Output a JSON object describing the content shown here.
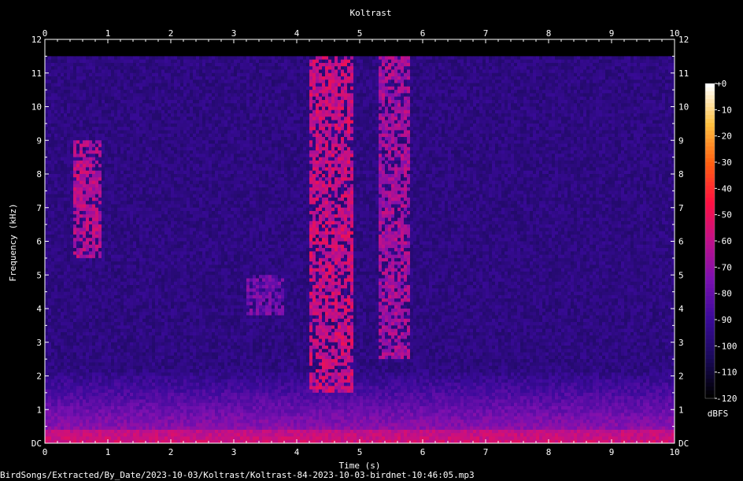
{
  "chart_data": {
    "type": "heatmap",
    "title": "Koltrast",
    "xlabel": "Time (s)",
    "ylabel": "Frequency (kHz)",
    "xlim": [
      0,
      10
    ],
    "ylim": [
      0,
      12
    ],
    "x_ticks": [
      "0",
      "1",
      "2",
      "3",
      "4",
      "5",
      "6",
      "7",
      "8",
      "9",
      "10"
    ],
    "y_ticks": [
      "DC",
      "1",
      "2",
      "3",
      "4",
      "5",
      "6",
      "7",
      "8",
      "9",
      "10",
      "11",
      "12"
    ],
    "colorbar": {
      "label": "dBFS",
      "range": [
        -120,
        0
      ],
      "ticks": [
        "+0",
        "-10",
        "-20",
        "-30",
        "-40",
        "-50",
        "-60",
        "-70",
        "-80",
        "-90",
        "-100",
        "-110",
        "-120"
      ]
    },
    "grid": false,
    "colors": {
      "background": "#000000",
      "colormap": [
        "#000000",
        "#1a0a5a",
        "#3a0a9a",
        "#7a10b0",
        "#c0108a",
        "#ff1040",
        "#ff6010",
        "#ffc040",
        "#ffffff"
      ]
    },
    "events": [
      {
        "t_start": 0.45,
        "t_end": 0.9,
        "f_low": 5.5,
        "f_high": 9.0,
        "level_db": -62
      },
      {
        "t_start": 3.2,
        "t_end": 3.8,
        "f_low": 3.8,
        "f_high": 5.0,
        "level_db": -78
      },
      {
        "t_start": 4.2,
        "t_end": 4.9,
        "f_low": 1.5,
        "f_high": 11.5,
        "level_db": -58
      },
      {
        "t_start": 5.3,
        "t_end": 5.8,
        "f_low": 2.5,
        "f_high": 11.5,
        "level_db": -66
      }
    ]
  },
  "footer": {
    "path": "BirdSongs/Extracted/By_Date/2023-10-03/Koltrast/Koltrast-84-2023-10-03-birdnet-10:46:05.mp3"
  }
}
